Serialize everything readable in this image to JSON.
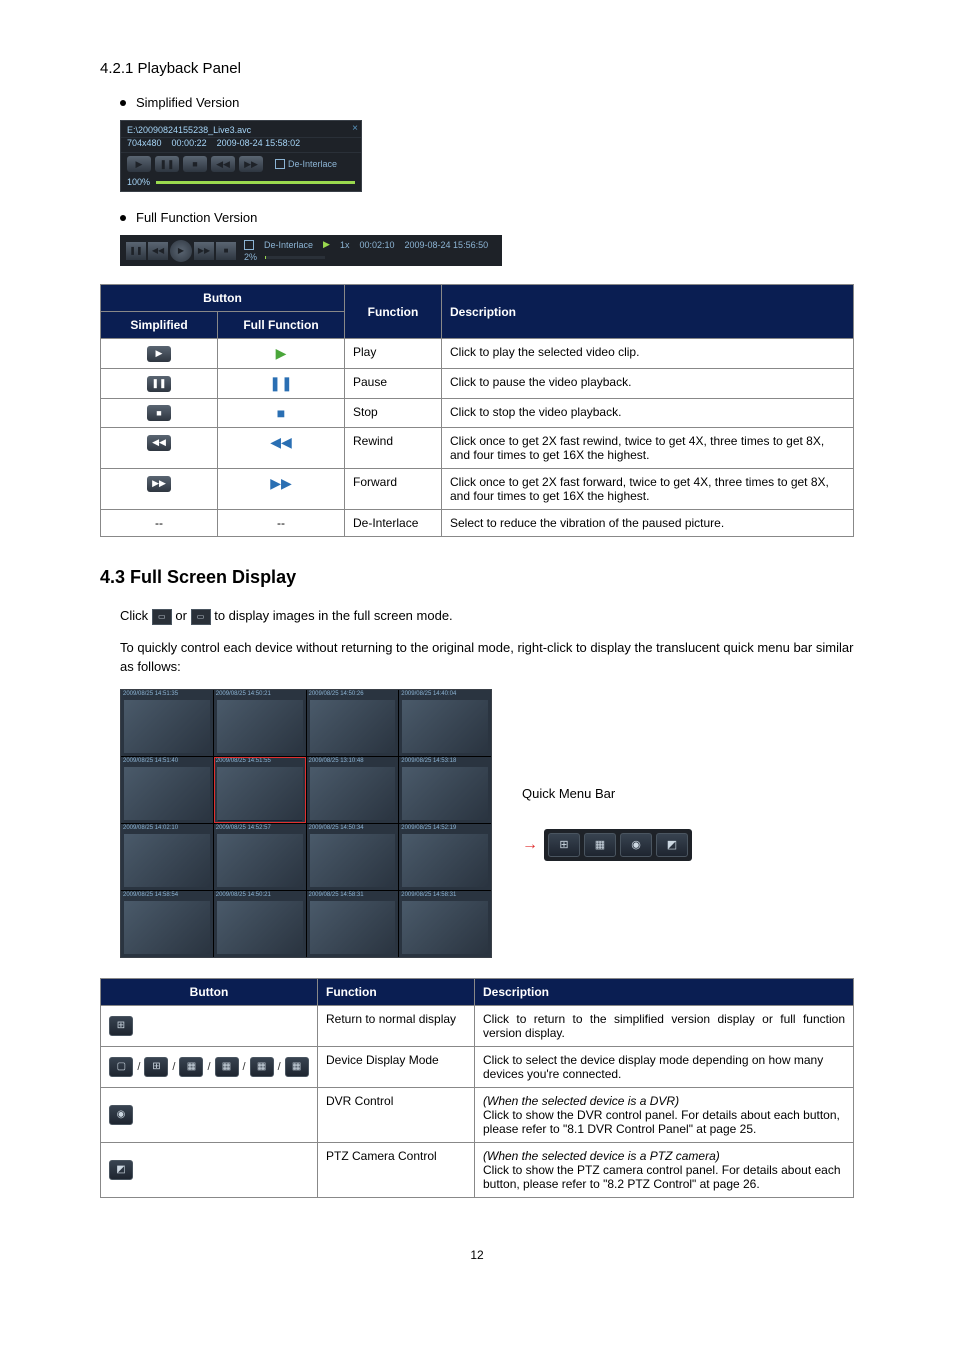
{
  "section_421": "4.2.1 Playback Panel",
  "bullet_simplified": "Simplified Version",
  "bullet_fullfunc": "Full Function Version",
  "simp_panel": {
    "close": "×",
    "filename": "E:\\20090824155238_Live3.avc",
    "res": "704x480",
    "elapsed": "00:00:22",
    "datetime": "2009-08-24 15:58:02",
    "deinterlace": "De-Interlace",
    "progress_label": "100%"
  },
  "full_panel": {
    "deinterlace": "De-Interlace",
    "speed": "1x",
    "time": "00:02:10",
    "datetime": "2009-08-24 15:56:50",
    "progress_label": "2%"
  },
  "table1": {
    "h_button": "Button",
    "h_simplified": "Simplified",
    "h_fullfunc": "Full Function",
    "h_function": "Function",
    "h_description": "Description",
    "rows": [
      {
        "func": "Play",
        "desc": "Click to play the selected video clip."
      },
      {
        "func": "Pause",
        "desc": "Click to pause the video playback."
      },
      {
        "func": "Stop",
        "desc": "Click to stop the video playback."
      },
      {
        "func": "Rewind",
        "desc": "Click once to get 2X fast rewind, twice to get 4X, three times to get 8X, and four times to get 16X the highest."
      },
      {
        "func": "Forward",
        "desc": "Click once to get 2X fast forward, twice to get 4X, three times to get 8X, and four times to get 16X the highest."
      },
      {
        "func": "De-Interlace",
        "desc": "Select to reduce the vibration of the paused picture."
      }
    ],
    "dash": "--"
  },
  "section_43": "4.3 Full Screen Display",
  "para_click_prefix": "Click ",
  "para_click_or": " or ",
  "para_click_suffix": " to display images in the full screen mode.",
  "para_quick": "To quickly control each device without returning to the original mode, right-click to display the translucent quick menu bar similar as follows:",
  "qmb_label": "Quick Menu Bar",
  "table2": {
    "h_button": "Button",
    "h_function": "Function",
    "h_description": "Description",
    "rows": [
      {
        "func": "Return to normal display",
        "desc": "Click to return to the simplified version display or full function version display."
      },
      {
        "func": "Device Display Mode",
        "desc": "Click to select the device display mode depending on how many devices you're connected."
      },
      {
        "func": "DVR Control",
        "desc_italic": "(When the selected device is a DVR)",
        "desc": "Click to show the DVR control panel. For details about each button, please refer to \"8.1 DVR Control Panel\" at page 25."
      },
      {
        "func": "PTZ Camera Control",
        "desc_italic": "(When the selected device is a PTZ camera)",
        "desc": "Click to show the PTZ camera control panel. For details about each button, please refer to \"8.2 PTZ Control\" at page 26."
      }
    ]
  },
  "page_number": "12"
}
